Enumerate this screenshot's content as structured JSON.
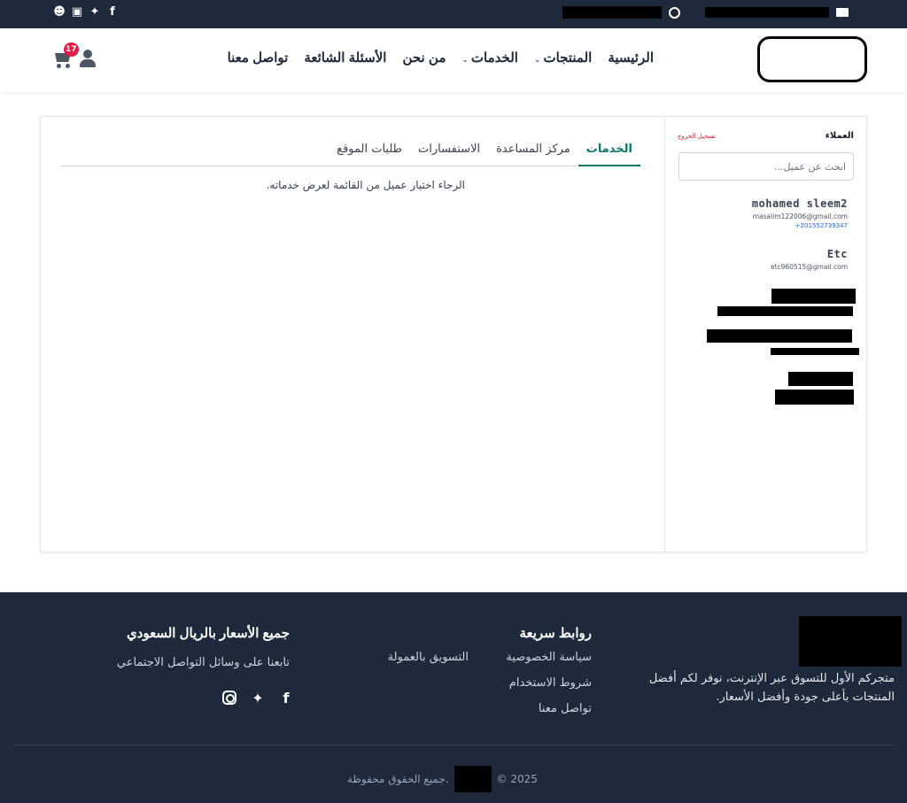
{
  "topbar": {
    "social_icons": [
      "facebook-icon",
      "twitter-icon",
      "instagram-icon",
      "snapchat-icon"
    ],
    "contact_icons": [
      "whatsapp-icon",
      "mail-icon"
    ]
  },
  "nav": {
    "menu": [
      {
        "label": "الرئيسية",
        "dropdown": false
      },
      {
        "label": "المنتجات",
        "dropdown": true
      },
      {
        "label": "الخدمات",
        "dropdown": true
      },
      {
        "label": "من نحن",
        "dropdown": false
      },
      {
        "label": "الأسئلة الشائعة",
        "dropdown": false
      },
      {
        "label": "تواصل معنا",
        "dropdown": false
      }
    ],
    "caret": "⌄",
    "cart_count": "17"
  },
  "sidebar": {
    "title": "العملاء",
    "logout": "تسجيل الخروج",
    "search_placeholder": "ابحث عن عميل...",
    "clients": [
      {
        "name": "mohamed sleem2",
        "email": "masalim122006@gmail.com",
        "phone": "+201552739347"
      },
      {
        "name": "Etc",
        "email": "etc960515@gmail.com",
        "phone": ""
      }
    ]
  },
  "tabs": [
    "الخدمات",
    "مركز المساعدة",
    "الاستفسارات",
    "طلبات الموقع"
  ],
  "active_tab": "الخدمات",
  "empty_message": "الرجاء اختيار عميل من القائمة لعرض خدماته.",
  "footer": {
    "about": "متجركم الأول للتسوق عبر الإنترنت، نوفر لكم أفضل المنتجات بأعلى جودة وأفضل الأسعار.",
    "quick_links_title": "روابط سريعة",
    "links_col1": [
      "سياسة الخصوصية",
      "شروط الاستخدام",
      "تواصل معنا"
    ],
    "links_col2": [
      "التسويق بالعمولة"
    ],
    "prices_title": "جميع الأسعار بالريال السعودي",
    "follow_text": "تابعنا على وسائل التواصل الاجتماعي",
    "social_icons": [
      "facebook-icon",
      "twitter-icon",
      "instagram-icon"
    ],
    "copyright_year": "© 2025",
    "copyright_text": "جميع الحقوق محفوظة."
  },
  "colors": {
    "dark": "#1e293b",
    "accent": "#0f766e",
    "badge": "#e11d48",
    "logout": "#dc2626",
    "phone": "#2563eb"
  }
}
